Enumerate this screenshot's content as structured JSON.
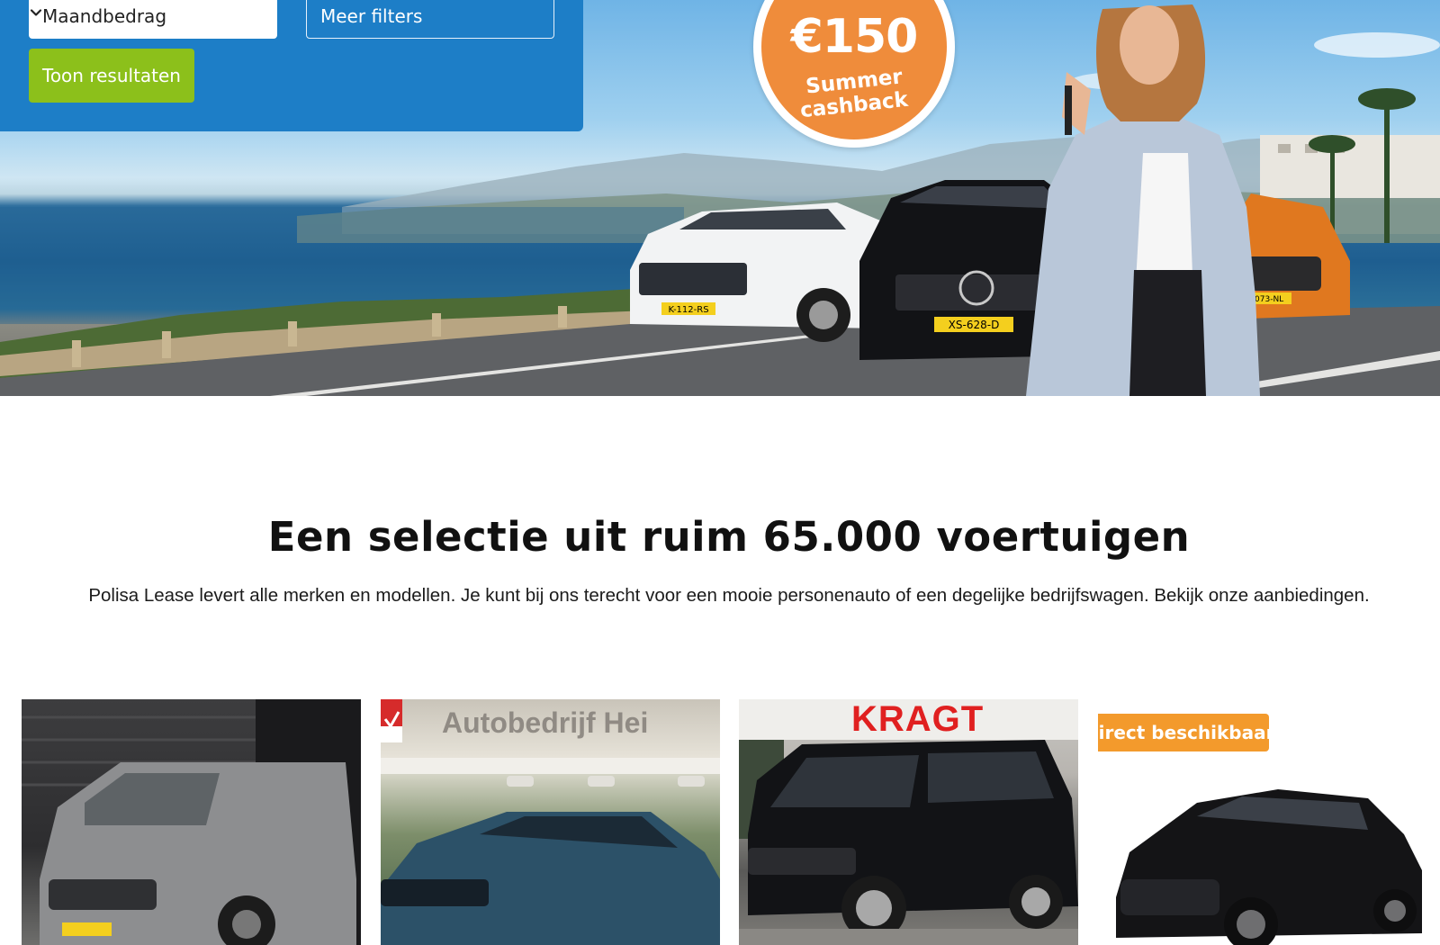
{
  "filters": {
    "monthly_select": "Maandbedrag",
    "more_filters": "Meer filters",
    "show_results": "Toon resultaten"
  },
  "hero": {
    "cashback_amount": "€150",
    "cashback_line1": "Summer",
    "cashback_line2": "cashback",
    "plates": [
      "K-112-RS",
      "XS-628-D",
      "G-073-NL"
    ]
  },
  "section": {
    "title": "Een selectie uit ruim 65.000 voertuigen",
    "intro": "Polisa Lease levert alle merken en modellen. Je kunt bij ons terecht voor een mooie personenauto of een degelijke bedrijfswagen. Bekijk onze aanbiedingen."
  },
  "cards": [
    {
      "alt": "grey van"
    },
    {
      "dealer": "Autobedrijf Hei"
    },
    {
      "dealer": "KRAGT"
    },
    {
      "badge": "Direct beschikbaar"
    }
  ],
  "colors": {
    "panel_blue": "#1d7ec7",
    "button_green": "#8cc01b",
    "cashback_orange": "#ef8c3b",
    "badge_orange": "#f39a2c"
  }
}
